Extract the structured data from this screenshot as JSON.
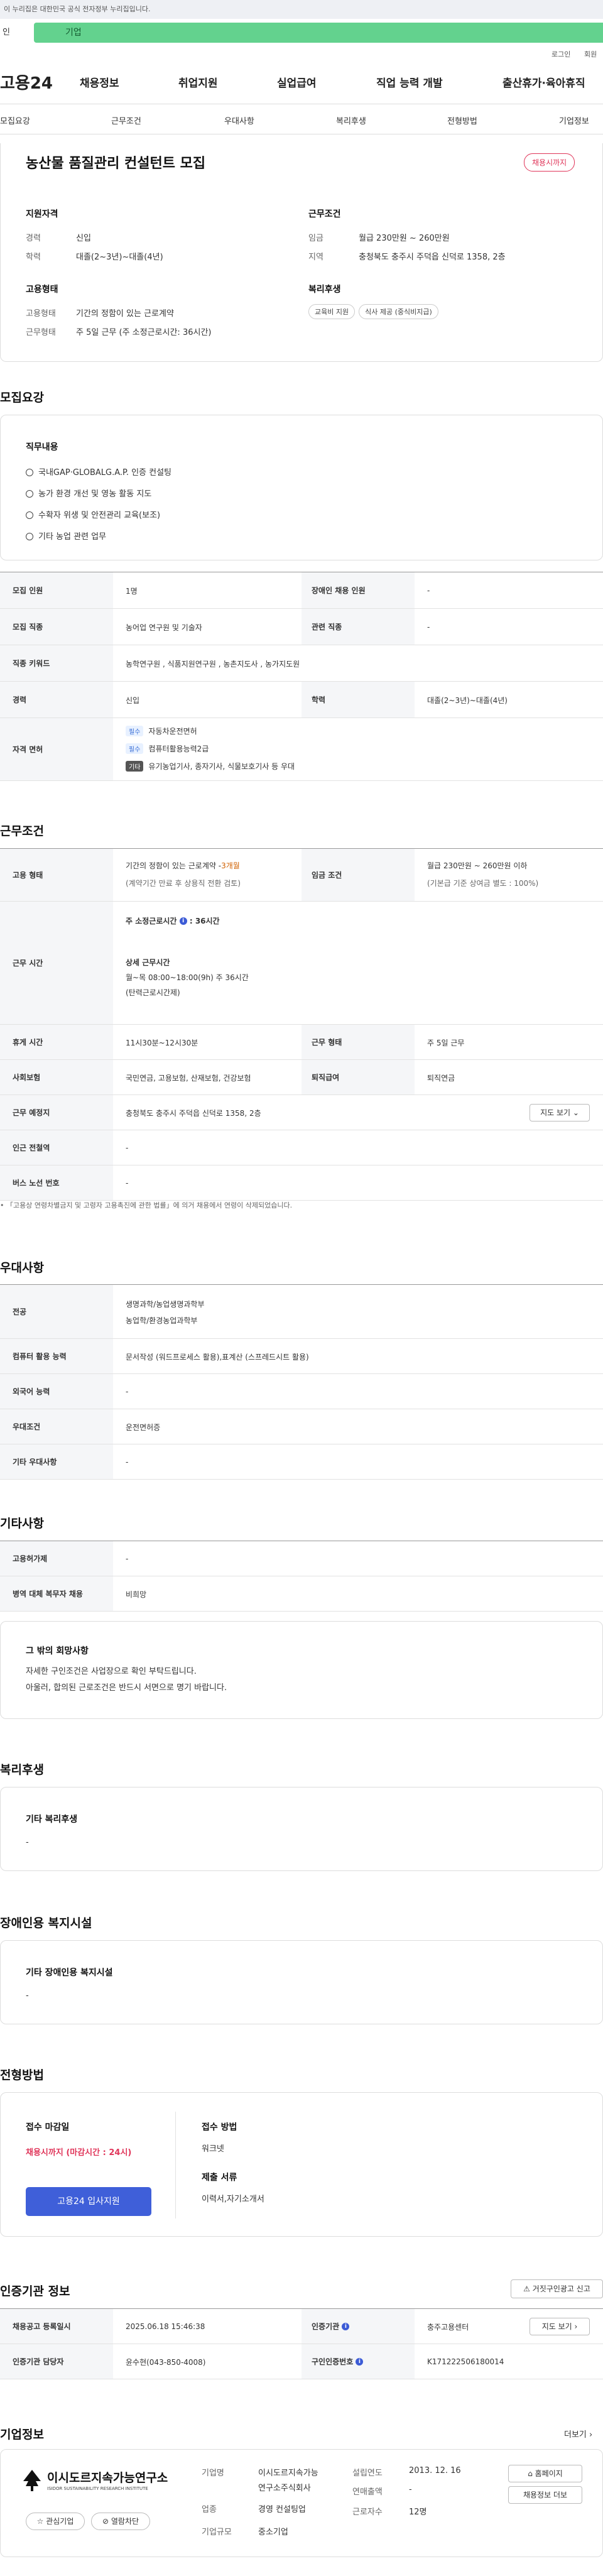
{
  "gov_banner": "이 누리집은 대한민국 공식 전자정부 누리집입니다.",
  "channel": {
    "personal": "인",
    "company": "기업"
  },
  "util": {
    "login": "로그인",
    "join": "회원"
  },
  "gnb": {
    "logo": "고용24",
    "menu": [
      "채용정보",
      "취업지원",
      "실업급여",
      "직업 능력 개발",
      "출산휴가·육아휴직"
    ]
  },
  "tabs": [
    "모집요강",
    "근무조건",
    "우대사항",
    "복리후생",
    "전형방법",
    "기업정보"
  ],
  "job": {
    "title": "농산물 품질관리 컨설턴트 모집",
    "badge": "채용시까지",
    "qual": {
      "head": "지원자격",
      "career_k": "경력",
      "career_v": "신입",
      "edu_k": "학력",
      "edu_v": "대졸(2~3년)~대졸(4년)"
    },
    "cond": {
      "head": "근무조건",
      "wage_k": "임금",
      "wage_v": "월급 230만원 ~ 260만원",
      "loc_k": "지역",
      "loc_v": "충청북도 충주시 주덕읍 신덕로 1358, 2층"
    },
    "emp": {
      "head": "고용형태",
      "type_k": "고용형태",
      "type_v": "기간의 정함이 있는 근로계약",
      "form_k": "근무형태",
      "form_v": "주 5일 근무 (주 소정근로시간: 36시간)"
    },
    "welfare": {
      "head": "복리후생",
      "pills": [
        "교육비 지원",
        "식사 제공 (중식비지급)"
      ]
    }
  },
  "recruit": {
    "head": "모집요강",
    "duty_head": "직무내용",
    "duties": [
      "국내GAP·GLOBALG.A.P. 인증 컨설팅",
      "농가 환경 개선 및 영농 활동 지도",
      "수확자 위생 및 안전관리 교육(보조)",
      "기타 농업 관련 업무"
    ],
    "r1": {
      "k1": "모집 인원",
      "v1": "1명",
      "k2": "장애인 채용 인원",
      "v2": "-"
    },
    "r2": {
      "k1": "모집 직종",
      "v1": "농어업 연구원 및 기술자",
      "k2": "관련 직종",
      "v2": "-"
    },
    "r3": {
      "k1": "직종 키워드",
      "v1": "농학연구원 , 식품지원연구원 , 농촌지도사 , 농가지도원"
    },
    "r4": {
      "k1": "경력",
      "v1": "신입",
      "k2": "학력",
      "v2": "대졸(2~3년)~대졸(4년)"
    },
    "r5": {
      "k1": "자격 면허",
      "items": [
        {
          "tag": "필수",
          "text": "자동차운전면허"
        },
        {
          "tag": "필수",
          "text": "컴퓨터활용능력2급"
        },
        {
          "tag": "기타",
          "text": "유기농업기사, 종자기사, 식물보호기사 등 우대"
        }
      ]
    }
  },
  "work": {
    "head": "근무조건",
    "r1": {
      "k1": "고용 형태",
      "v1a": "기간의 정함이 있는 근로계약 - ",
      "v1b": "3개월",
      "v1c": "(계약기간 만료 후 상용직 전환 검토)",
      "k2": "임금 조건",
      "v2a": "월급 230만원 ~ 260만원 이하",
      "v2b": "(기본급 기준 상여금 별도 : 100%)"
    },
    "r2": {
      "k1": "근무 시간",
      "t1": "주 소정근로시간",
      "t1v": ": 36시간",
      "t2": "상세 근무시간",
      "t3": "월~목 08:00~18:00(9h) 주 36시간",
      "t4": "(탄력근로시간제)"
    },
    "r3": {
      "k1": "휴게 시간",
      "v1": "11시30분~12시30분",
      "k2": "근무 형태",
      "v2": "주 5일 근무"
    },
    "r4": {
      "k1": "사회보험",
      "v1": "국민연금, 고용보험, 산재보험, 건강보험",
      "k2": "퇴직급여",
      "v2": "퇴직연금"
    },
    "r5": {
      "k1": "근무 예정지",
      "v1": "충청북도 충주시 주덕읍 신덕로 1358, 2층",
      "btn": "지도 보기"
    },
    "r6": {
      "k1": "인근 전철역",
      "v1": "-"
    },
    "r7": {
      "k1": "버스 노선 번호",
      "v1": "-"
    },
    "note": "• 「고용상 연령차별금지 및 고령자 고용촉진에 관한 법률」에 의거 채용에서 연령이 삭제되었습니다."
  },
  "pref": {
    "head": "우대사항",
    "r1": {
      "k": "전공",
      "v1": "생명과학/농업생명과학부",
      "v2": "농업학/환경농업과학부"
    },
    "r2": {
      "k": "컴퓨터 활용 능력",
      "v": "문서작성 (워드프로세스 활용),표계산 (스프레드시트 활용)"
    },
    "r3": {
      "k": "외국어 능력",
      "v": "-"
    },
    "r4": {
      "k": "우대조건",
      "v": "운전면허증"
    },
    "r5": {
      "k": "기타 우대사항",
      "v": "-"
    }
  },
  "etc": {
    "head": "기타사항",
    "r1": {
      "k": "고용허가제",
      "v": "-"
    },
    "r2": {
      "k": "병역 대체 복무자 채용",
      "v": "비희망"
    },
    "box_head": "그 밖의 회망사항",
    "box_l1": "자세한 구인조건은 사업장으로 확인 부탁드립니다.",
    "box_l2": "아울러, 합의된 근로조건은 반드시 서면으로 명기 바랍니다."
  },
  "welfare": {
    "head": "복리후생",
    "sub": "기타 복리후생",
    "v": "-"
  },
  "disabled": {
    "head": "장애인용 복지시설",
    "sub": "기타 장애인용 복지시설",
    "v": "-"
  },
  "process": {
    "head": "전형방법",
    "deadline_k": "접수 마감일",
    "deadline_v": "채용시까지 (마감시간 : 24시)",
    "apply_btn": "고용24 입사지원",
    "method_k": "접수 방법",
    "method_v": "워크넷",
    "docs_k": "제출 서류",
    "docs_v": "이력서,자기소개서"
  },
  "agency": {
    "head": "인증기관 정보",
    "fake_btn": "거짓구인광고 신고",
    "r1": {
      "k1": "채용공고 등록일시",
      "v1": "2025.06.18 15:46:38",
      "k2": "인증기관",
      "v2": "충주고용센터",
      "btn": "지도 보기"
    },
    "r2": {
      "k1": "인증기관 담당자",
      "v1": "윤수현(043-850-4008)",
      "k2": "구인인증번호",
      "v2": "K171222506180014"
    }
  },
  "company": {
    "head": "기업정보",
    "more": "더보기",
    "logo_main": "이시도르지속가능연구소",
    "logo_sub": "ISIDOR SUSTAINABILITY RESEARCH INSTITUTE",
    "fav": "관심기업",
    "block": "열람차단",
    "name_k": "기업명",
    "name_v1": "이시도르지속가능",
    "name_v2": "연구소주식회사",
    "ind_k": "업종",
    "ind_v1": "경영 컨설팅업",
    "size_k": "기업규모",
    "size_v": "중소기업",
    "est_k": "설립연도",
    "est_v": "2013. 12. 16",
    "sales_k": "연매출액",
    "sales_v": "-",
    "emp_k": "근로자수",
    "emp_v": "12명",
    "home_btn": "홈페이지",
    "list_btn": "채용정보 더보"
  }
}
